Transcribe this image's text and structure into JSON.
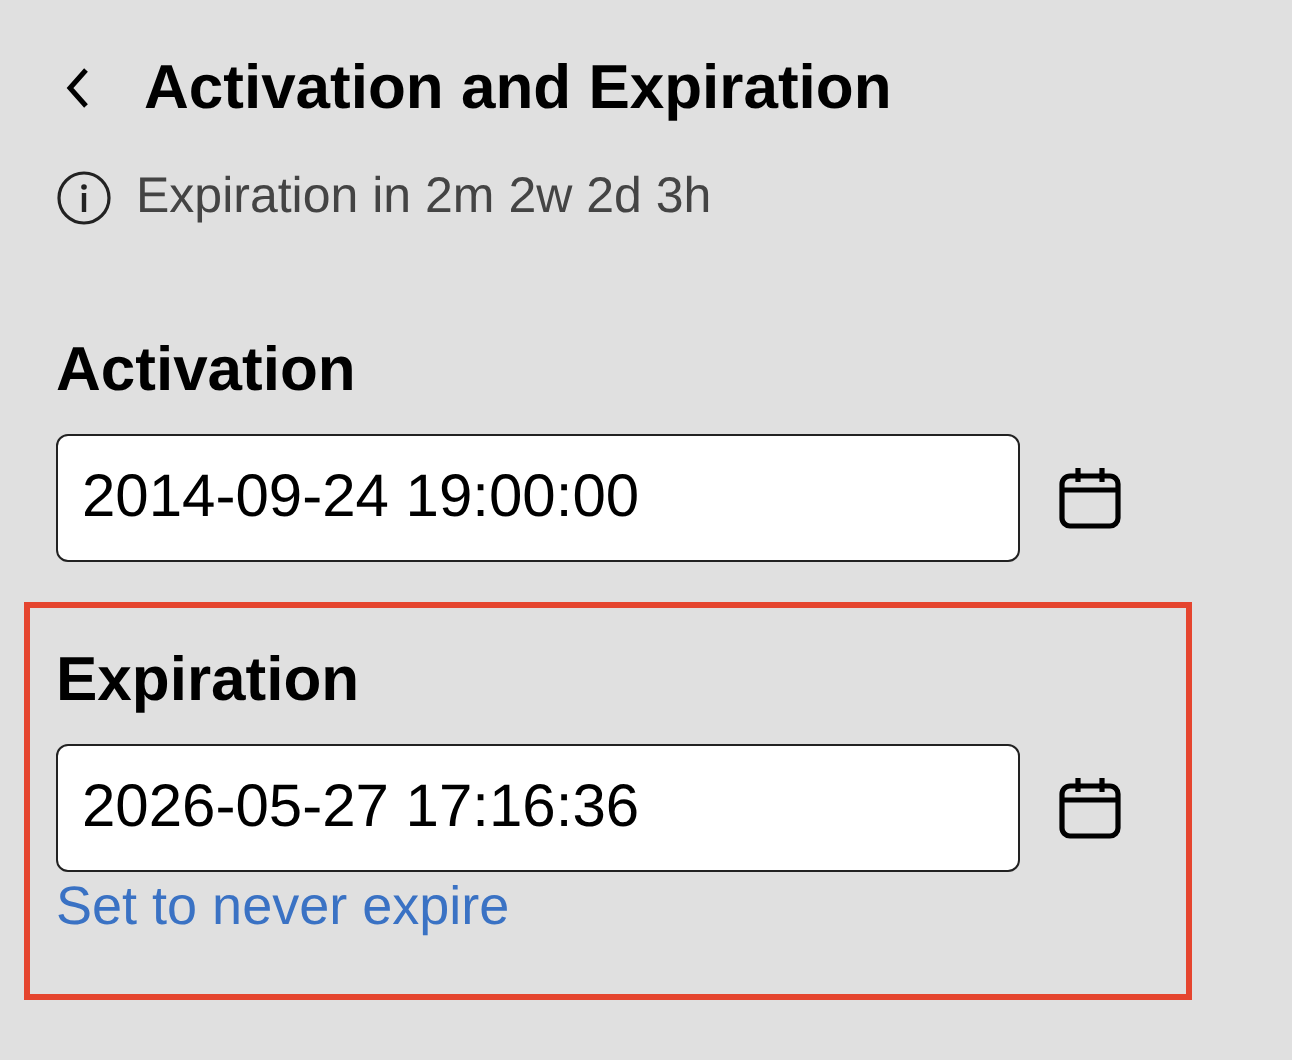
{
  "header": {
    "title": "Activation and Expiration"
  },
  "info": "Expiration in 2m 2w 2d 3h",
  "sections": [
    {
      "label": "Activation",
      "value": "2014-09-24 19:00:00",
      "highlighted": false
    },
    {
      "label": "Expiration",
      "value": "2026-05-27 17:16:36",
      "highlighted": true,
      "link": "Set to never expire"
    }
  ]
}
